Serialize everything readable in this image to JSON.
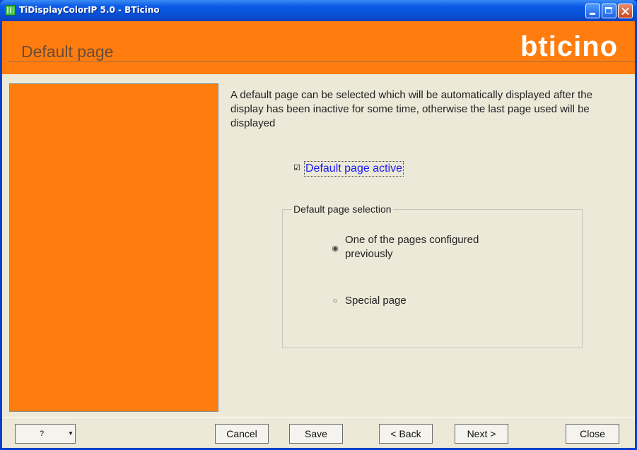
{
  "window": {
    "title": "TiDisplayColorIP 5.0 - BTicino"
  },
  "header": {
    "title": "Default page",
    "logo_text": "bticino",
    "colors": {
      "accent": "#ff7d0f"
    }
  },
  "main": {
    "description": "A default page can be selected which will be automatically displayed after the display has been inactive for some time, otherwise the last page used will be displayed",
    "checkbox": {
      "label": "Default page active",
      "checked": true
    },
    "group": {
      "label": "Default page selection",
      "options": [
        {
          "label": "One of the pages configured previously",
          "selected": true
        },
        {
          "label": "Special page",
          "selected": false
        }
      ]
    }
  },
  "footer": {
    "help_label": "?",
    "cancel_label": "Cancel",
    "save_label": "Save",
    "back_label": "< Back",
    "next_label": "Next >",
    "close_label": "Close"
  }
}
